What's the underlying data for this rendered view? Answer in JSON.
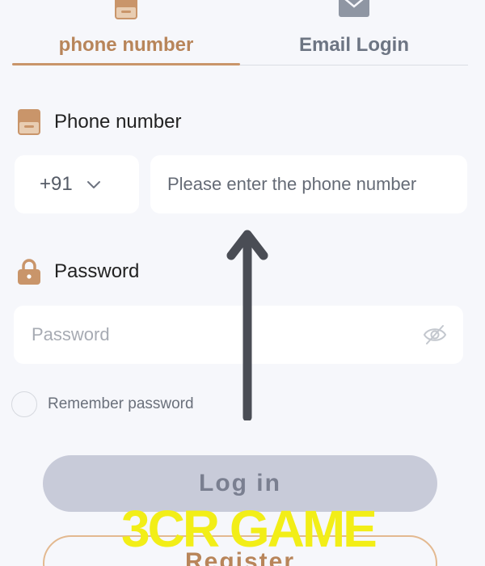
{
  "tabs": {
    "phone": {
      "label": "phone number",
      "icon": "phone-icon"
    },
    "email": {
      "label": "Email Login",
      "icon": "mail-icon"
    }
  },
  "phone_field": {
    "label": "Phone number",
    "label_icon": "phone-icon",
    "country_code": "+91",
    "placeholder": "Please enter the phone number",
    "value": ""
  },
  "password_field": {
    "label": "Password",
    "label_icon": "lock-icon",
    "placeholder": "Password",
    "value": "",
    "toggle_icon": "eye-off-icon"
  },
  "remember": {
    "label": "Remember password",
    "checked": false
  },
  "buttons": {
    "login": "Log in",
    "register": "Register"
  },
  "watermark": "3CR GAME",
  "colors": {
    "accent": "#c9956a",
    "accent_text": "#b8855a",
    "background": "#f6f7fb",
    "login_button": "#c8cbd9",
    "watermark": "#f2ee17"
  }
}
